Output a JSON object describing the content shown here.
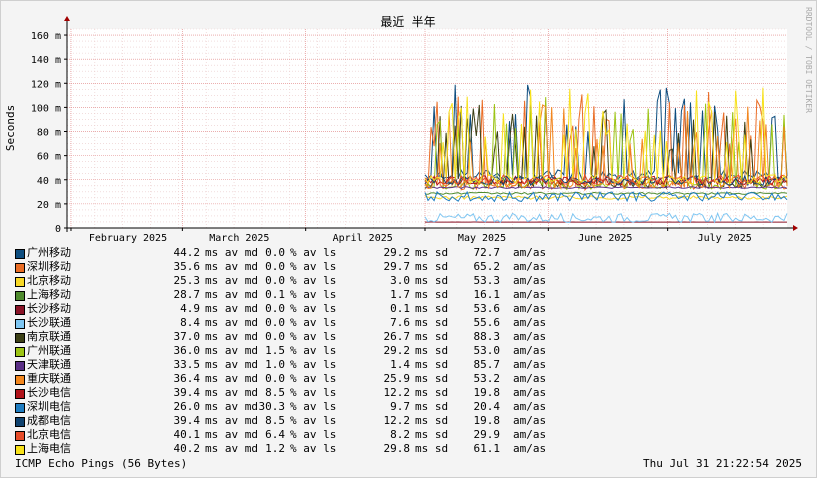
{
  "chart_data": {
    "type": "line",
    "title": "最近 半年",
    "ylabel": "Seconds",
    "side_label": "RRDTOOL / TOBI OETIKER",
    "ylim": [
      0,
      165
    ],
    "y_ticks": [
      0,
      20,
      40,
      60,
      80,
      100,
      120,
      140,
      160
    ],
    "y_tick_labels": [
      "0",
      "20 m",
      "40 m",
      "60 m",
      "80 m",
      "100 m",
      "120 m",
      "140 m",
      "160 m"
    ],
    "x_domain": [
      "2025-01-31",
      "2025-07-31"
    ],
    "x_ticks": [
      {
        "date": "2025-02-01",
        "label": "February 2025"
      },
      {
        "date": "2025-03-01",
        "label": "March 2025"
      },
      {
        "date": "2025-04-01",
        "label": "April 2025"
      },
      {
        "date": "2025-05-01",
        "label": "May 2025"
      },
      {
        "date": "2025-06-01",
        "label": "June 2025"
      },
      {
        "date": "2025-07-01",
        "label": "July 2025"
      }
    ],
    "data_start": "2025-05-01",
    "grid": true,
    "series": [
      {
        "name": "广州移动",
        "color": "#0d4d7f",
        "avg": "44.2",
        "ls": "0.0",
        "sd": "29.2",
        "am": "72.7"
      },
      {
        "name": "深圳移动",
        "color": "#ea6d26",
        "avg": "35.6",
        "ls": "0.0",
        "sd": "29.7",
        "am": "65.2"
      },
      {
        "name": "北京移动",
        "color": "#f7d826",
        "avg": "25.3",
        "ls": "0.0",
        "sd": "3.0",
        "am": "53.3"
      },
      {
        "name": "上海移动",
        "color": "#4e8a2d",
        "avg": "28.7",
        "ls": "0.1",
        "sd": "1.7",
        "am": "16.1"
      },
      {
        "name": "长沙移动",
        "color": "#8a1428",
        "avg": "4.9",
        "ls": "0.0",
        "sd": "0.1",
        "am": "53.6"
      },
      {
        "name": "长沙联通",
        "color": "#7ec6f2",
        "avg": "8.4",
        "ls": "0.0",
        "sd": "7.6",
        "am": "55.6"
      },
      {
        "name": "南京联通",
        "color": "#3c4016",
        "avg": "37.0",
        "ls": "0.0",
        "sd": "26.7",
        "am": "88.3"
      },
      {
        "name": "广州联通",
        "color": "#9cc414",
        "avg": "36.0",
        "ls": "1.5",
        "sd": "29.2",
        "am": "53.0"
      },
      {
        "name": "天津联通",
        "color": "#5a2f86",
        "avg": "33.5",
        "ls": "1.0",
        "sd": "1.4",
        "am": "85.7"
      },
      {
        "name": "重庆联通",
        "color": "#f2861e",
        "avg": "36.4",
        "ls": "0.0",
        "sd": "25.9",
        "am": "53.2"
      },
      {
        "name": "长沙电信",
        "color": "#b0131a",
        "avg": "39.4",
        "ls": "8.5",
        "sd": "12.2",
        "am": "19.8"
      },
      {
        "name": "深圳电信",
        "color": "#1f7dc1",
        "avg": "26.0",
        "ls": "30.3",
        "sd": "9.7",
        "am": "20.4"
      },
      {
        "name": "成都电信",
        "color": "#10426f",
        "avg": "39.4",
        "ls": "8.5",
        "sd": "12.2",
        "am": "19.8"
      },
      {
        "name": "北京电信",
        "color": "#e74d2a",
        "avg": "40.1",
        "ls": "6.4",
        "sd": "8.2",
        "am": "29.9"
      },
      {
        "name": "上海电信",
        "color": "#f7e11a",
        "avg": "40.2",
        "ls": "1.2",
        "sd": "29.8",
        "am": "61.1"
      }
    ],
    "units": {
      "avg": "ms av md",
      "ls": "% av ls",
      "sd": "ms sd",
      "am": "am/as"
    }
  },
  "footer": {
    "left": "ICMP Echo Pings (56 Bytes)",
    "right": "Thu Jul 31 21:22:54 2025"
  }
}
